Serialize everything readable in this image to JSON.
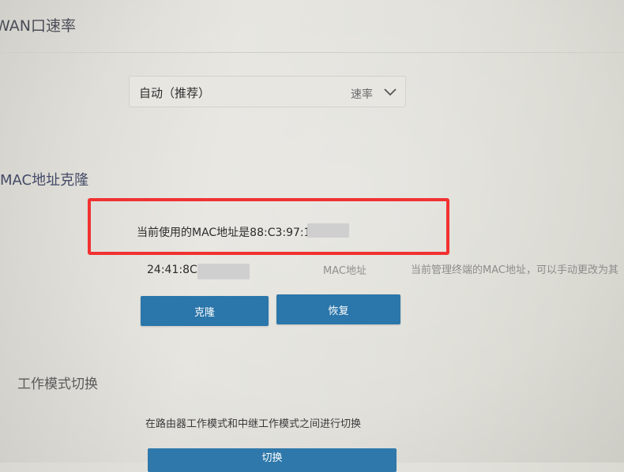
{
  "wan_section": {
    "title": "WAN口速率",
    "select_value": "自动（推荐）",
    "select_suffix": "速率"
  },
  "mac_section": {
    "title": "MAC地址克隆",
    "current_mac_text": "当前使用的MAC地址是88:C3:97:1",
    "mac_value": "24:41:8C",
    "mac_label": "MAC地址",
    "mac_hint": "当前管理终端的MAC地址，可以手动更改为其",
    "clone_label": "克隆",
    "restore_label": "恢复"
  },
  "mode_section": {
    "title": "工作模式切换",
    "description": "在路由器工作模式和中继工作模式之间进行切换",
    "switch_label": "切换"
  },
  "colors": {
    "button_blue": "#2b76aa",
    "highlight_red": "#f23131"
  }
}
